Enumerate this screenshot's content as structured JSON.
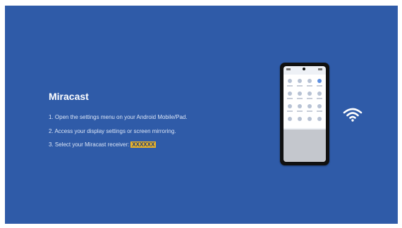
{
  "title": "Miracast",
  "steps": [
    "1. Open the settings menu on your Android Mobile/Pad.",
    "2. Access your display settings or screen mirroring.",
    "3. Select your Miracast receiver:"
  ],
  "receiver_name": "XXXXXX",
  "colors": {
    "background": "#2f5ba8",
    "highlight": "#e8b22a",
    "text": "#ffffff"
  },
  "icons": [
    "phone-illustration",
    "wifi-icon"
  ]
}
